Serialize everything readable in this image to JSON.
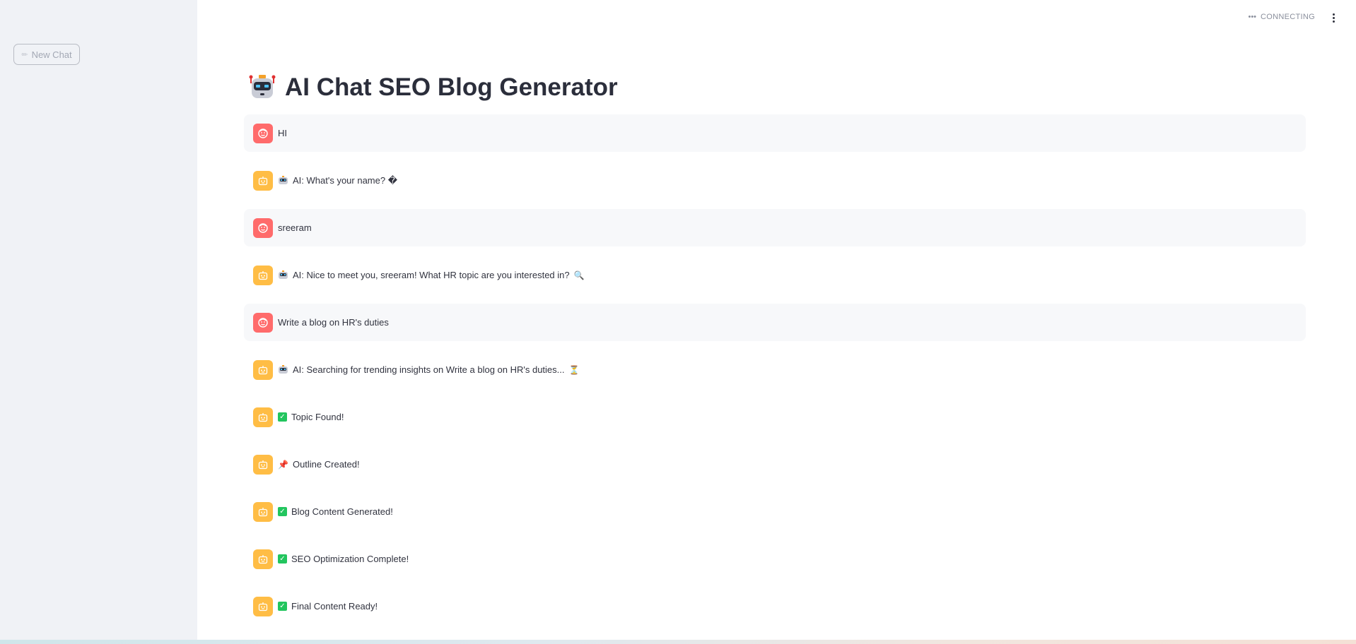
{
  "sidebar": {
    "new_chat_label": "New Chat",
    "new_chat_icon": "pencil-icon"
  },
  "status": {
    "text": "CONNECTING",
    "icon": "dots-icon"
  },
  "page": {
    "title": "AI Chat SEO Blog Generator",
    "title_icon": "robot-icon"
  },
  "messages": [
    {
      "role": "user",
      "text": "HI"
    },
    {
      "role": "ai",
      "prefix": "robot",
      "text": "AI: What's your name? �",
      "suffix": ""
    },
    {
      "role": "user",
      "text": "sreeram"
    },
    {
      "role": "ai",
      "prefix": "robot",
      "text": "AI: Nice to meet you, sreeram! What HR topic are you interested in?",
      "suffix": "🔍"
    },
    {
      "role": "user",
      "text": "Write a blog on HR's duties"
    },
    {
      "role": "ai",
      "prefix": "robot",
      "text": "AI: Searching for trending insights on Write a blog on HR's duties...",
      "suffix": "⏳"
    },
    {
      "role": "ai",
      "prefix": "check",
      "text": "Topic Found!",
      "suffix": ""
    },
    {
      "role": "ai",
      "prefix": "pin",
      "text": "Outline Created!",
      "suffix": ""
    },
    {
      "role": "ai",
      "prefix": "check",
      "text": "Blog Content Generated!",
      "suffix": ""
    },
    {
      "role": "ai",
      "prefix": "check",
      "text": "SEO Optimization Complete!",
      "suffix": ""
    },
    {
      "role": "ai",
      "prefix": "check",
      "text": "Final Content Ready!",
      "suffix": ""
    }
  ],
  "colors": {
    "user_avatar": "#ff6b6b",
    "ai_avatar": "#ffbd45",
    "sidebar_bg": "#f0f2f6",
    "user_msg_bg": "#f7f8fa"
  }
}
